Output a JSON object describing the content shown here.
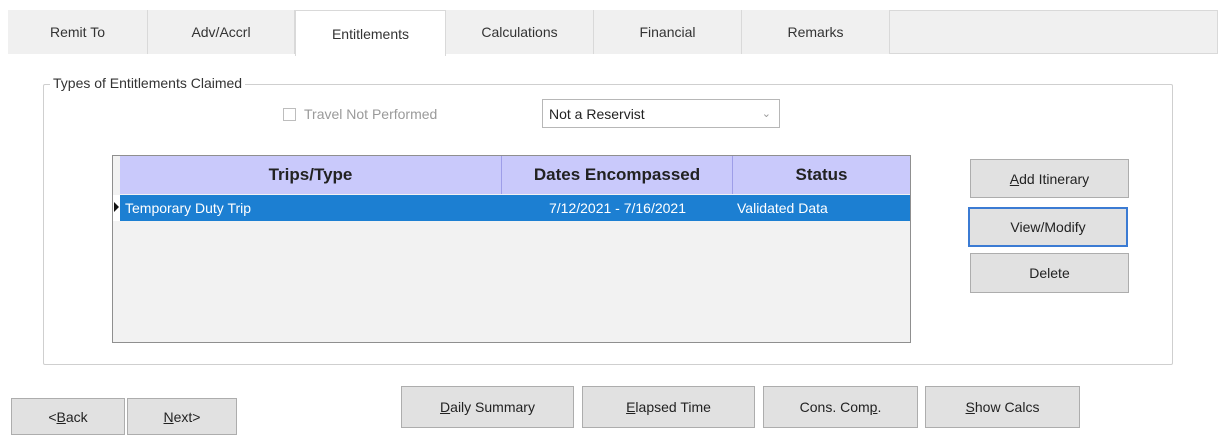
{
  "tabs": [
    "Remit To",
    "Adv/Accrl",
    "Entitlements",
    "Calculations",
    "Financial",
    "Remarks"
  ],
  "group_title": "Types of Entitlements Claimed",
  "travel_not_performed": {
    "label": "Travel Not Performed",
    "checked": false,
    "enabled": false
  },
  "reservist_select": {
    "value": "Not a Reservist"
  },
  "grid": {
    "columns": [
      "Trips/Type",
      "Dates Encompassed",
      "Status"
    ],
    "rows": [
      {
        "type": "Temporary Duty Trip",
        "dates": "7/12/2021 - 7/16/2021",
        "status": "Validated Data",
        "selected": true
      }
    ]
  },
  "side_buttons": {
    "add_itinerary": {
      "pre": "",
      "key": "A",
      "post": "dd Itinerary"
    },
    "view_modify": "View/Modify",
    "delete": "Delete"
  },
  "bottom_buttons": {
    "back": {
      "pre": "<",
      "key": "B",
      "post": "ack"
    },
    "next": {
      "pre": "",
      "key": "N",
      "post": "ext>"
    },
    "daily_summary": {
      "pre": "",
      "key": "D",
      "post": "aily Summary"
    },
    "elapsed_time": {
      "pre": "",
      "key": "E",
      "post": "lapsed Time"
    },
    "cons_comp": {
      "pre": "Cons. Com",
      "key": "p",
      "post": "."
    },
    "show_calcs": {
      "pre": "",
      "key": "S",
      "post": "how Calcs"
    }
  },
  "colors": {
    "header_bg": "#c9c9fb",
    "selected_row": "#1c7fd2",
    "button_bg": "#e1e1e1"
  }
}
